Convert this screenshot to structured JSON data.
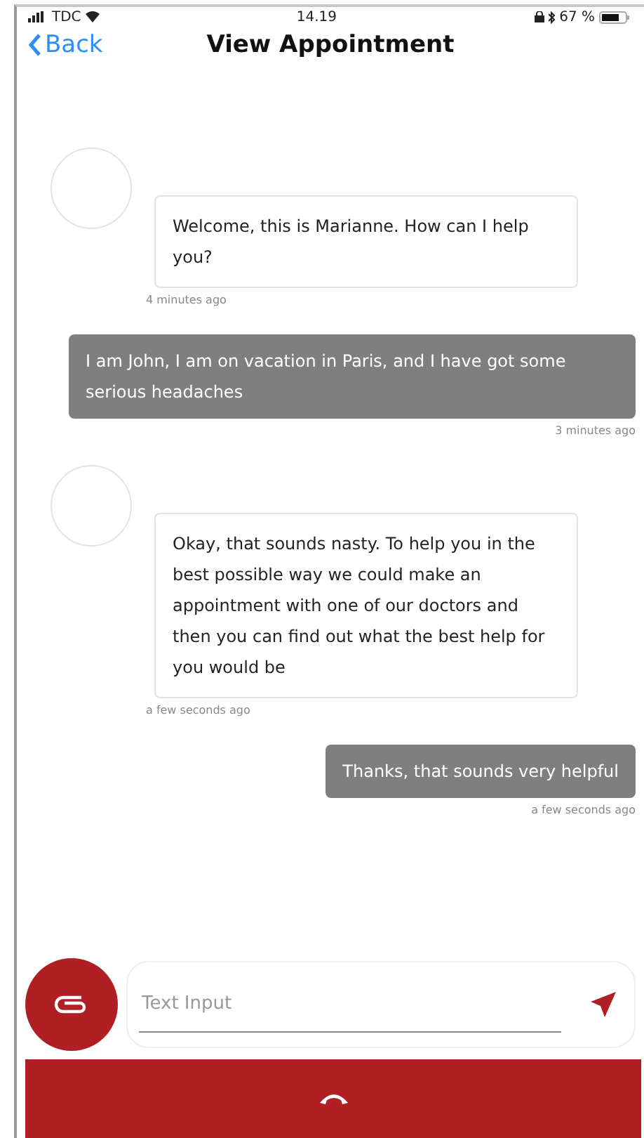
{
  "status_bar": {
    "carrier": "TDC",
    "time": "14.19",
    "battery": "67 %"
  },
  "nav": {
    "back": "Back",
    "title": "View Appointment"
  },
  "messages": [
    {
      "kind": "incoming",
      "text": "Welcome, this is Marianne. How can I help you?",
      "time": "4 minutes ago"
    },
    {
      "kind": "outgoing",
      "text": "I am John, I am on vacation in Paris, and I have got some serious headaches",
      "time": "3 minutes ago"
    },
    {
      "kind": "incoming",
      "text": "Okay, that sounds nasty. To help you in the best possible way we could make an appointment with one of our doctors and then you can find out what the best help for you would be",
      "time": "a few seconds ago"
    },
    {
      "kind": "outgoing",
      "text": "Thanks, that sounds very helpful",
      "time": "a few seconds ago"
    }
  ],
  "composer": {
    "placeholder": "Text Input"
  }
}
